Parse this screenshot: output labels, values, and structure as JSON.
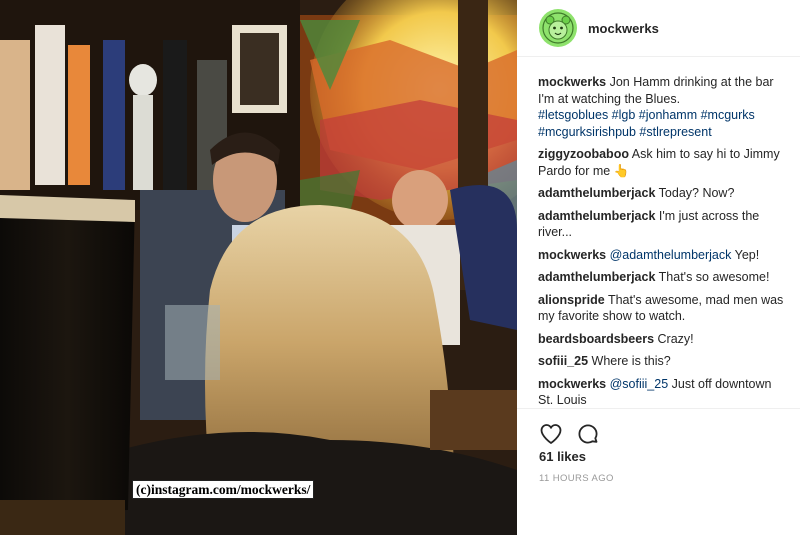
{
  "photo": {
    "watermark": "(c)instagram.com/mockwerks/"
  },
  "header": {
    "username": "mockwerks",
    "avatar_icon": "bear-logo-icon",
    "avatar_color": "#8ee26c"
  },
  "caption": {
    "user": "mockwerks",
    "text": "Jon Hamm drinking at the bar I'm at watching the Blues.",
    "hashtags": "#letsgoblues #lgb #jonhamm #mcgurks #mcgurksirishpub #stlrepresent"
  },
  "comments": [
    {
      "user": "ziggyzoobaboo",
      "text": "Ask him to say hi to Jimmy Pardo for me 👆"
    },
    {
      "user": "adamthelumberjack",
      "text": "Today? Now?"
    },
    {
      "user": "adamthelumberjack",
      "text": "I'm just across the river..."
    },
    {
      "user": "mockwerks",
      "mention": "@adamthelumberjack",
      "text": "Yep!"
    },
    {
      "user": "adamthelumberjack",
      "text": "That's so awesome!"
    },
    {
      "user": "alionspride",
      "text": "That's awesome, mad men was my favorite show to watch."
    },
    {
      "user": "beardsboardsbeers",
      "text": "Crazy!"
    },
    {
      "user": "sofiii_25",
      "text": "Where is this?"
    },
    {
      "user": "mockwerks",
      "mention": "@sofiii_25",
      "text": "Just off downtown St. Louis"
    }
  ],
  "actions": {
    "like_icon": "heart-icon",
    "comment_icon": "comment-bubble-icon"
  },
  "likes": "61 likes",
  "timestamp": "11 HOURS AGO",
  "colors": {
    "link": "#003569",
    "text": "#262626",
    "muted": "#999999"
  }
}
